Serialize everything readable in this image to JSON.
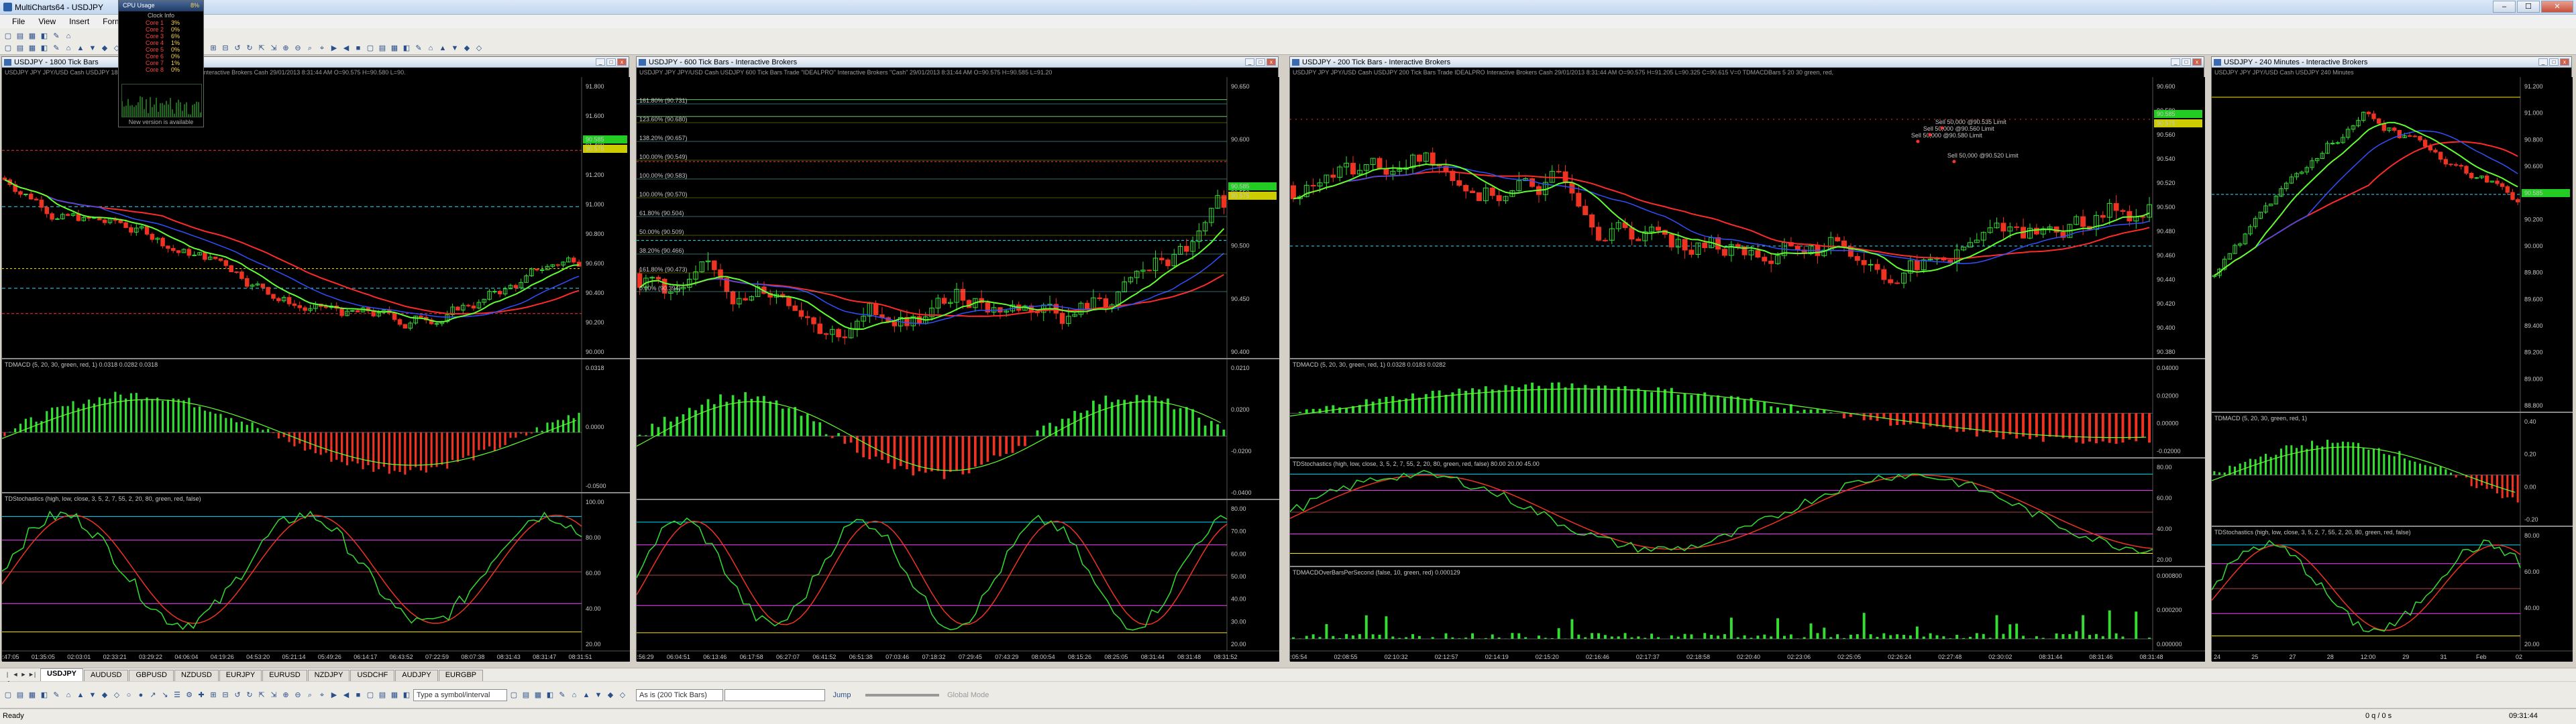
{
  "app": {
    "title": "MultiCharts64 - USDJPY",
    "window_buttons": [
      "–",
      "☐",
      "✕"
    ]
  },
  "menu": [
    "File",
    "View",
    "Insert",
    "Format"
  ],
  "cpu_widget": {
    "title": "CPU Usage",
    "percent": "8%",
    "subtitle": "Clock Info",
    "rows": [
      {
        "core": "Core 1",
        "value": "3%"
      },
      {
        "core": "Core 2",
        "value": "0%"
      },
      {
        "core": "Core 3",
        "value": "6%"
      },
      {
        "core": "Core 4",
        "value": "1%"
      },
      {
        "core": "Core 5",
        "value": "0%"
      },
      {
        "core": "Core 6",
        "value": "0%"
      },
      {
        "core": "Core 7",
        "value": "1%"
      },
      {
        "core": "Core 8",
        "value": "0%"
      }
    ],
    "note": "New version is available"
  },
  "charts": [
    {
      "title": "USDJPY - 1800 Tick Bars",
      "info": "USDJPY  JPY  JPY/USD Cash USDJPY  1800 Tick Bars  Trade  IDEALPRO  Interactive Brokers  Cash  29/01/2013  8:31:44 AM  O=90.575  H=90.580  L=90.",
      "price_ticks": [
        "91.800",
        "91.600",
        "91.400",
        "91.200",
        "91.000",
        "90.800",
        "90.600",
        "90.400",
        "90.200",
        "90.000"
      ],
      "price_tags": [
        "90.585",
        "90.575"
      ],
      "pane2_label": "TDMACD (5, 20, 30, green, red, 1)  0.0318  0.0282  0.0318",
      "pane2_ticks": [
        "0.0318",
        "0.0000",
        "-0.0500"
      ],
      "pane3_label": "TDStochastics (high, low, close, 3, 5, 2, 7, 55, 2, 20, 80, green, red, false)",
      "pane3_ticks": [
        "100.00",
        "80.00",
        "60.00",
        "40.00",
        "20.00"
      ],
      "time_ticks": [
        "00:47:05",
        "01:35:05",
        "02:03:01",
        "02:33:21",
        "03:29:22",
        "04:06:04",
        "04:19:26",
        "04:53:20",
        "05:21:14",
        "05:49:26",
        "06:14:17",
        "06:43:52",
        "07:22:59",
        "08:07:38",
        "08:31:43",
        "08:31:47",
        "08:31:51"
      ]
    },
    {
      "title": "USDJPY - 600 Tick Bars - Interactive Brokers",
      "info": "USDJPY  JPY  JPY/USD Cash USDJPY  600 Tick Bars  Trade \"IDEALPRO\" Interactive Brokers \"Cash\"  29/01/2013  8:31:44 AM  O=90.575  H=90.585  L=91.20",
      "fib_labels": [
        "161.80% (90.731)",
        "123.60% (90.680)",
        "138.20% (90.657)",
        "100.00% (90.549)",
        "100.00% (90.583)",
        "100.00% (90.570)",
        "61.80% (90.504)",
        "50.00% (90.509)",
        "38.20% (90.466)",
        "161.80% (90.473)",
        "0.00% (90.394)"
      ],
      "price_ticks": [
        "90.650",
        "90.600",
        "90.550",
        "90.500",
        "90.450",
        "90.400"
      ],
      "price_tags": [
        "90.585",
        "90.575"
      ],
      "pane2_label": "",
      "pane2_ticks": [
        "0.0210",
        "0.0200",
        "-0.0200",
        "-0.0400"
      ],
      "pane3_ticks": [
        "80.00",
        "70.00",
        "60.00",
        "50.00",
        "40.00",
        "30.00",
        "20.00"
      ],
      "time_ticks": [
        "05:56:29",
        "06:04:51",
        "06:13:46",
        "06:17:58",
        "06:27:07",
        "06:41:52",
        "06:51:38",
        "07:03:46",
        "07:18:32",
        "07:29:45",
        "07:43:29",
        "08:00:54",
        "08:15:26",
        "08:25:05",
        "08:31:44",
        "08:31:48",
        "08:31:52"
      ]
    },
    {
      "title": "USDJPY - 200 Tick Bars - Interactive Brokers",
      "info": "USDJPY  JPY  JPY/USD Cash USDJPY  200 Tick Bars  Trade  IDEALPRO  Interactive Brokers  Cash  29/01/2013  8:31:44 AM  O=90.575  H=91.205  L=90.325  C=90.615  V=0  TDMACDBars 5 20 30 green, red,",
      "trade_labels": [
        "Sell 50,000 @90.580 Limit",
        "Sell 50,000 @90.560 Limit",
        "Sell 50,000 @90.535 Limit",
        "Sell 50,000 @90.520 Limit"
      ],
      "price_ticks": [
        "90.600",
        "90.580",
        "90.560",
        "90.540",
        "90.520",
        "90.500",
        "90.480",
        "90.460",
        "90.440",
        "90.420",
        "90.400",
        "90.380"
      ],
      "price_tags": [
        "90.585",
        "90.575"
      ],
      "pane2_label": "TDMACD (5, 20, 30, green, red, 1)  0.0328  0.0183  0.0282",
      "pane2_ticks": [
        "0.04000",
        "0.02000",
        "0.00000",
        "-0.02000"
      ],
      "pane3_label": "TDStochastics (high, low, close, 3, 5, 2, 7, 55, 2, 20, 80, green, red, false)  80.00  20.00  45.00",
      "pane3_ticks": [
        "80.00",
        "60.00",
        "40.00",
        "20.00"
      ],
      "pane4_label": "TDMACDOverBarsPerSecond (false, 10, green, red)  0.000129",
      "pane4_ticks": [
        "0.000800",
        "0.000200",
        "0.000000"
      ],
      "time_ticks": [
        "02:05:54",
        "02:08:55",
        "02:10:32",
        "02:12:57",
        "02:14:19",
        "02:15:20",
        "02:16:46",
        "02:17:37",
        "02:18:58",
        "02:20:40",
        "02:23:06",
        "02:25:05",
        "02:26:24",
        "02:27:48",
        "02:30:02",
        "08:31:44",
        "08:31:46",
        "08:31:48"
      ]
    },
    {
      "title": "USDJPY - 240 Minutes - Interactive Brokers",
      "info": "USDJPY  JPY  JPY/USD Cash USDJPY  240 Minutes",
      "price_ticks": [
        "91.200",
        "91.000",
        "90.800",
        "90.600",
        "90.400",
        "90.200",
        "90.000",
        "89.800",
        "89.600",
        "89.400",
        "89.200",
        "89.000",
        "88.800"
      ],
      "price_tags": [
        "90.585"
      ],
      "pane2_label": "TDMACD (5, 20, 30, green, red, 1)",
      "pane2_ticks": [
        "0.40",
        "0.20",
        "0.00",
        "-0.20"
      ],
      "pane3_label": "TDStochastics (high, low, close, 3, 5, 2, 7, 55, 2, 20, 80, green, red, false)",
      "pane3_ticks": [
        "80.00",
        "60.00",
        "40.00",
        "20.00"
      ],
      "time_ticks": [
        "24",
        "25",
        "27",
        "28",
        "12:00",
        "29",
        "31",
        "Feb",
        "02"
      ]
    }
  ],
  "tabs": [
    "USDJPY",
    "AUDUSD",
    "GBPUSD",
    "NZDUSD",
    "EURJPY",
    "EURUSD",
    "NZDJPY",
    "USDCHF",
    "AUDJPY",
    "EURGBP"
  ],
  "drawbar": {
    "symbol_placeholder": "Type a symbol/interval",
    "interval": "As is (200 Tick Bars)",
    "jump_label": "Jump",
    "global_mode": "Global Mode"
  },
  "status": {
    "left": "Ready",
    "queue": "0 q / 0 s",
    "time": "09:31:44"
  },
  "colors": {
    "bg": "#000000",
    "up": "#33dd33",
    "down": "#ee3322",
    "ma_red": "#ff2a2a",
    "ma_blue": "#3050ff",
    "ma_green": "#60ff30",
    "cyan": "#00e0ff",
    "yellow": "#ffea00",
    "magenta": "#ff40ff"
  }
}
